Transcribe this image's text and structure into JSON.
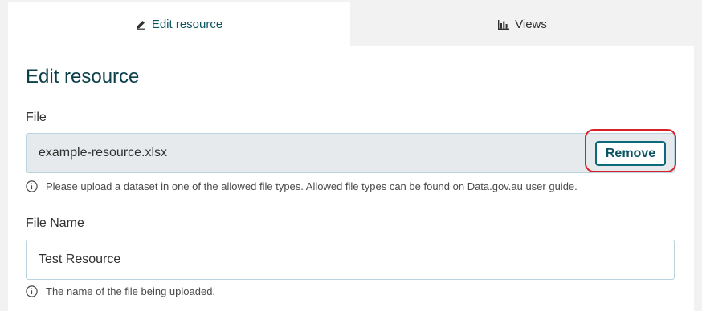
{
  "tabs": [
    {
      "label": "Edit resource",
      "icon": "pencil-icon",
      "active": true
    },
    {
      "label": "Views",
      "icon": "bar-chart-icon",
      "active": false
    }
  ],
  "heading": "Edit resource",
  "file": {
    "label": "File",
    "value": "example-resource.xlsx",
    "remove_label": "Remove",
    "hint": "Please upload a dataset in one of the allowed file types. Allowed file types can be found on Data.gov.au user guide."
  },
  "file_name": {
    "label": "File Name",
    "value": "Test Resource",
    "hint": "The name of the file being uploaded."
  },
  "colors": {
    "accent": "#0b5462",
    "highlight": "#d6202a",
    "background": "#f2f2f2"
  }
}
